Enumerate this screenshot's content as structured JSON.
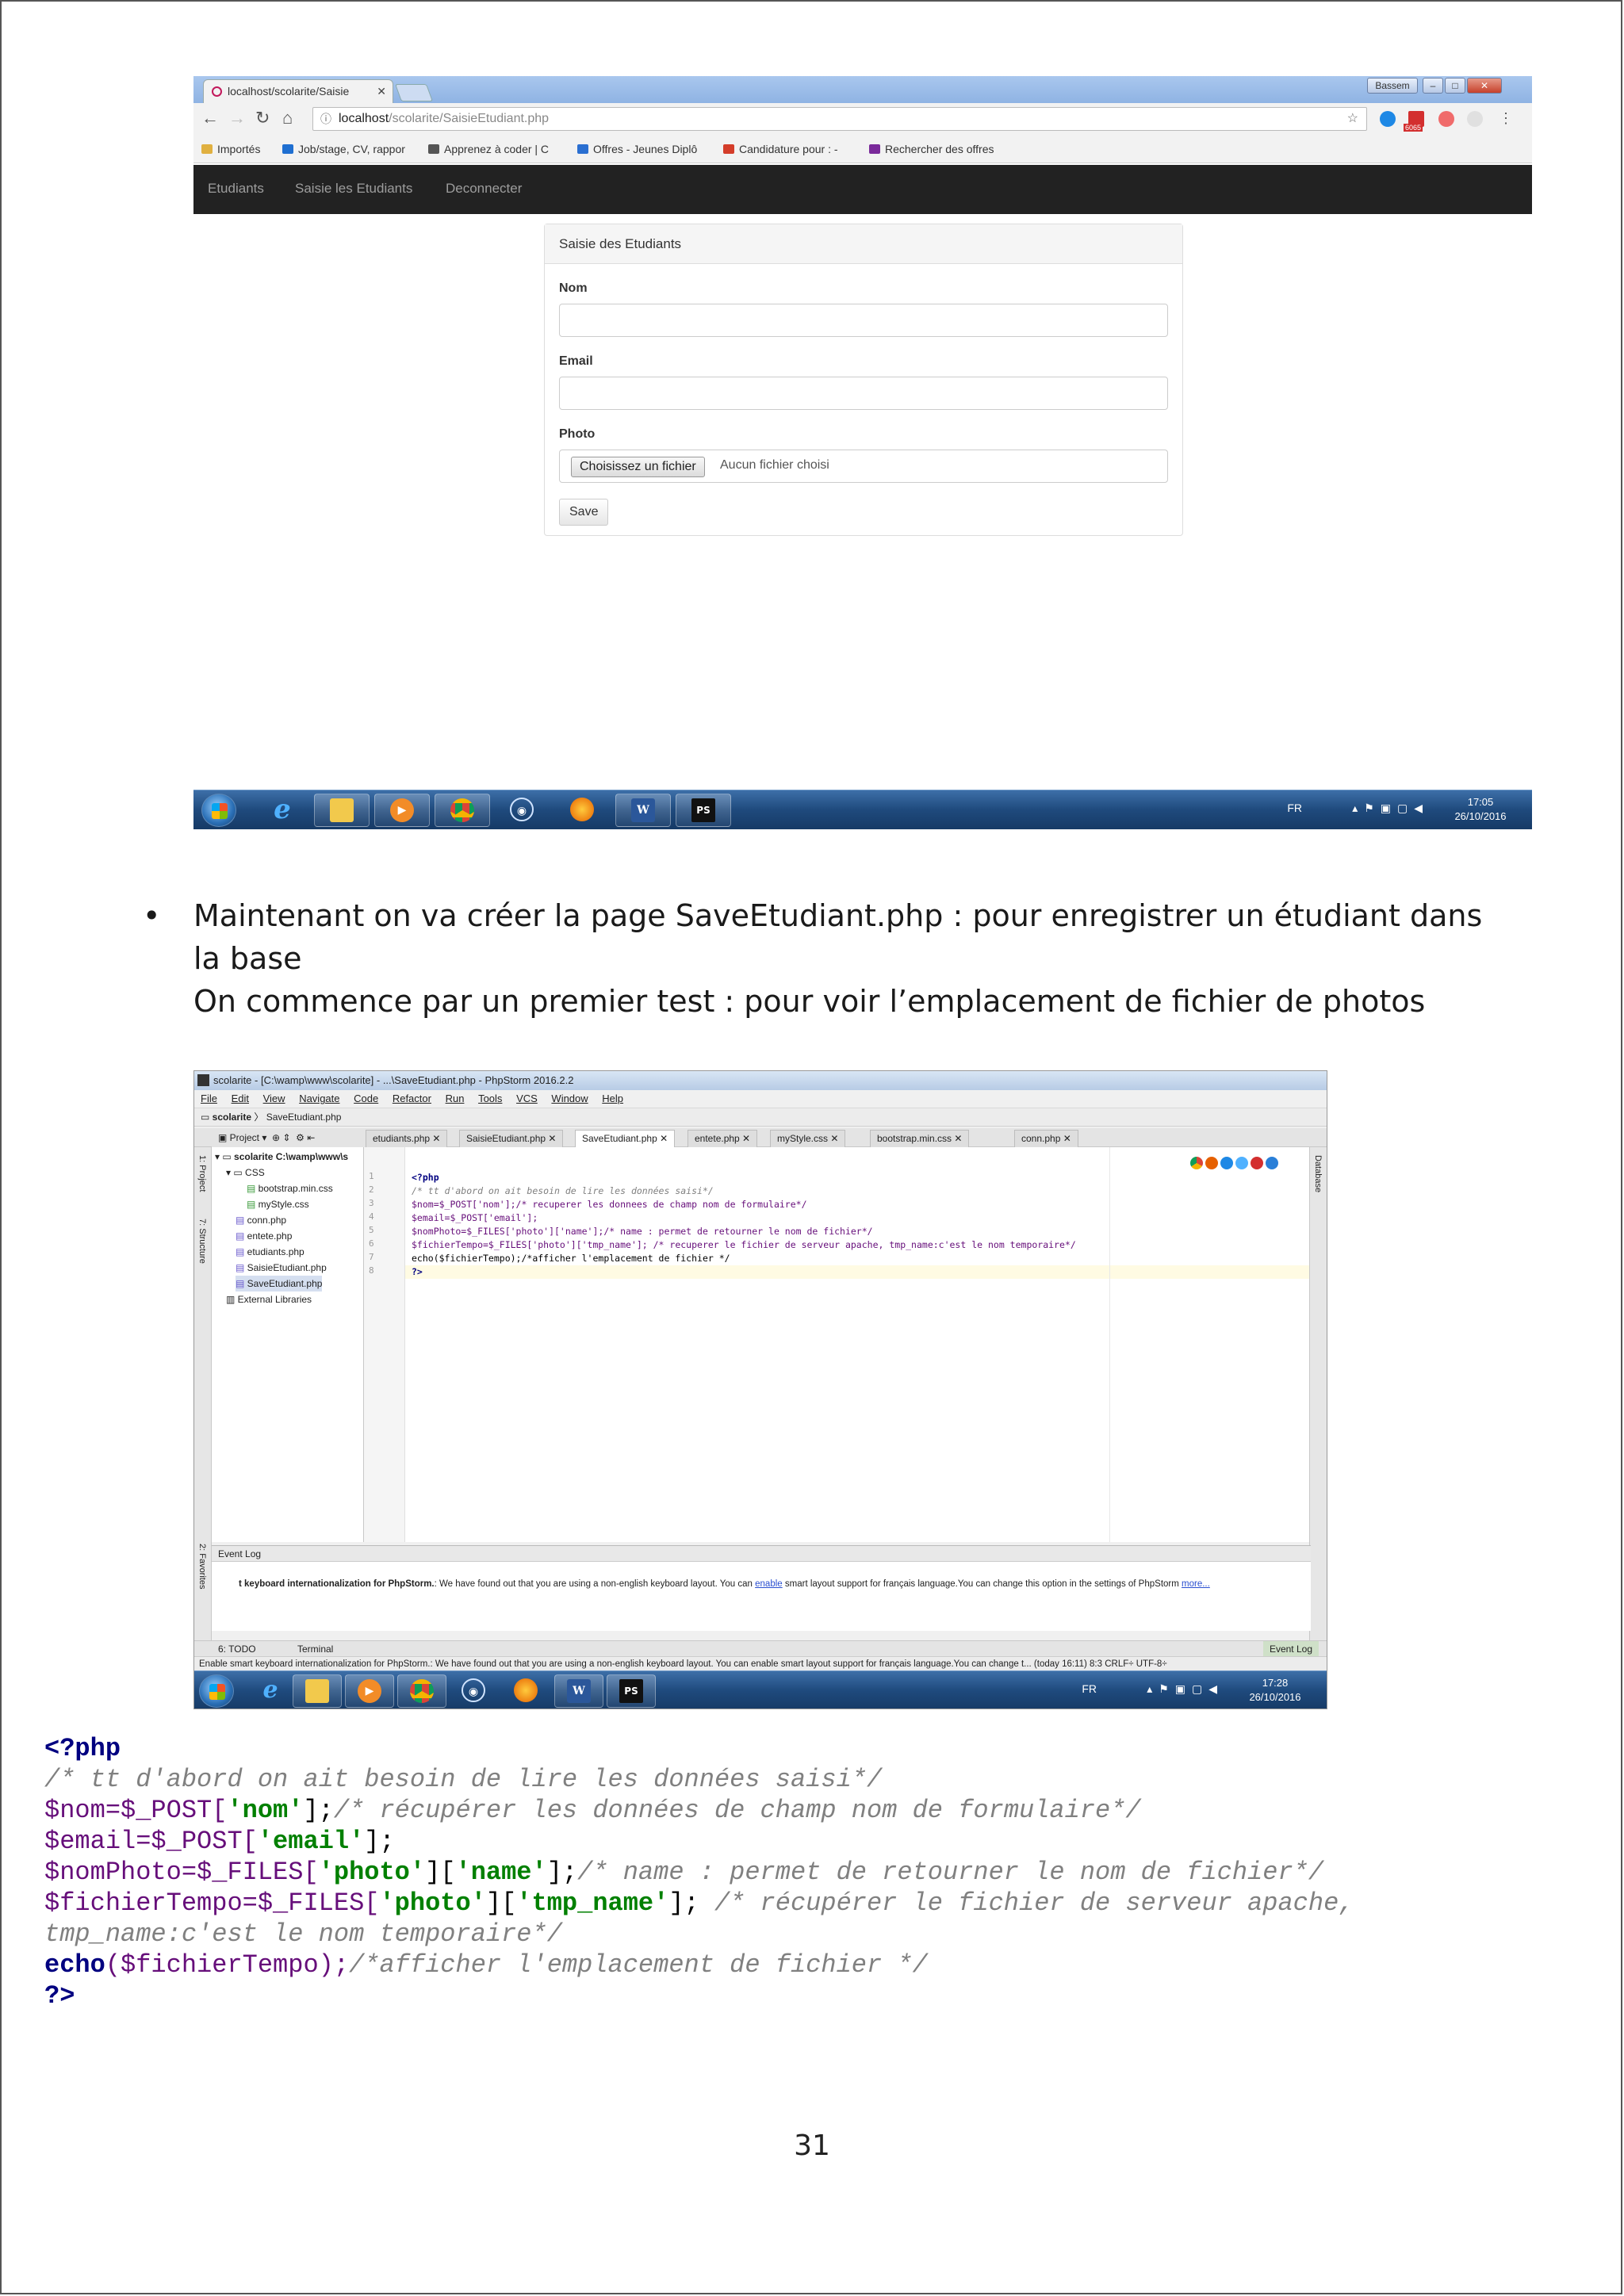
{
  "browser": {
    "tab_title": "localhost/scolarite/Saisie",
    "window_user": "Bassem",
    "url_host": "localhost",
    "url_path": "/scolarite/SaisieEtudiant.php",
    "extension_badge": "6065",
    "bookmarks": [
      {
        "label": "Importés",
        "color": "#e0b040"
      },
      {
        "label": "Job/stage, CV, rappor",
        "color": "#1f6fd1"
      },
      {
        "label": "Apprenez à coder | C",
        "color": "#555555"
      },
      {
        "label": "Offres - Jeunes Diplô",
        "color": "#2a6fd1"
      },
      {
        "label": "Candidature pour : -",
        "color": "#d43d2a"
      },
      {
        "label": "Rechercher des offres",
        "color": "#7a2a9a"
      }
    ]
  },
  "app": {
    "nav": [
      "Etudiants",
      "Saisie les Etudiants",
      "Deconnecter"
    ],
    "panel_title": "Saisie des Etudiants",
    "fields": {
      "nom": "Nom",
      "email": "Email",
      "photo": "Photo"
    },
    "file_button": "Choisissez un fichier",
    "file_status": "Aucun fichier choisi",
    "save_button": "Save"
  },
  "taskbar1": {
    "lang": "FR",
    "time": "17:05",
    "date": "26/10/2016"
  },
  "taskbar2": {
    "lang": "FR",
    "time": "17:28",
    "date": "26/10/2016"
  },
  "body": {
    "bullet_line1": "Maintenant on va créer la page SaveEtudiant.php : pour enregistrer un étudiant dans",
    "bullet_line2": "la base",
    "bullet_line3": "On commence par un premier test : pour voir l’emplacement de fichier de photos"
  },
  "ide": {
    "title": "scolarite - [C:\\wamp\\www\\scolarite] - ...\\SaveEtudiant.php - PhpStorm 2016.2.2",
    "menu": [
      "File",
      "Edit",
      "View",
      "Navigate",
      "Code",
      "Refactor",
      "Run",
      "Tools",
      "VCS",
      "Window",
      "Help"
    ],
    "breadcrumb": [
      "scolarite",
      "SaveEtudiant.php"
    ],
    "project_label": "Project",
    "tabs": [
      "etudiants.php",
      "SaisieEtudiant.php",
      "SaveEtudiant.php",
      "entete.php",
      "myStyle.css",
      "bootstrap.min.css",
      "conn.php"
    ],
    "active_tab": "SaveEtudiant.php",
    "tree": [
      {
        "label": "scolarite  C:\\wamp\\www\\s",
        "indent": 0,
        "icon": "folder-icon"
      },
      {
        "label": "CSS",
        "indent": 1,
        "icon": "folder-icon"
      },
      {
        "label": "bootstrap.min.css",
        "indent": 2,
        "icon": "css-file-icon"
      },
      {
        "label": "myStyle.css",
        "indent": 2,
        "icon": "css-file-icon"
      },
      {
        "label": "conn.php",
        "indent": 1,
        "icon": "php-file-icon"
      },
      {
        "label": "entete.php",
        "indent": 1,
        "icon": "php-file-icon"
      },
      {
        "label": "etudiants.php",
        "indent": 1,
        "icon": "php-file-icon"
      },
      {
        "label": "SaisieEtudiant.php",
        "indent": 1,
        "icon": "php-file-icon"
      },
      {
        "label": "SaveEtudiant.php",
        "indent": 1,
        "icon": "php-file-icon"
      },
      {
        "label": "External Libraries",
        "indent": 0,
        "icon": "library-icon"
      }
    ],
    "code": [
      "<?php",
      "/* tt d'abord on ait besoin de lire les données saisi*/",
      "$nom=$_POST['nom'];/* recuperer les donnees de champ nom de formulaire*/",
      "$email=$_POST['email'];",
      "$nomPhoto=$_FILES['photo']['name'];/* name : permet de retourner le nom de fichier*/",
      "$fichierTempo=$_FILES['photo']['tmp_name']; /* recuperer le fichier de serveur apache, tmp_name:c'est le nom temporaire*/",
      "echo($fichierTempo);/*afficher l'emplacement de fichier */",
      "?>"
    ],
    "side_left": [
      "1: Project",
      "7: Structure",
      "2: Favorites"
    ],
    "side_right": "Database",
    "event_log_title": "Event Log",
    "event_msg_bold": "t keyboard internationalization for PhpStorm.",
    "event_msg_text": ": We have found out that you are using a non-english keyboard layout. You can ",
    "event_msg_link": "enable",
    "event_msg_rest": " smart layout support for français language.You can change this option in the settings of PhpStorm ",
    "event_msg_more": "more...",
    "bottom_tabs": [
      "6: TODO",
      "Terminal"
    ],
    "event_log_tab": "Event Log",
    "status": "Enable smart keyboard internationalization for PhpStorm.: We have found out that you are using a non-english keyboard layout. You can enable smart layout support for français language.You can change t... (today 16:11)   8:3   CRLF÷   UTF-8÷"
  },
  "listing": {
    "l1": "<?php",
    "l2": "/* tt d'abord on ait besoin de lire les données saisi*/",
    "l3a": "$nom=$_POST[",
    "l3b": "'nom'",
    "l3c": "];",
    "l3d": "/* récupérer les données de champ nom de formulaire*/",
    "l4a": "$email=$_POST[",
    "l4b": "'email'",
    "l4c": "];",
    "l5a": "$nomPhoto=$_FILES[",
    "l5b": "'photo'",
    "l5c": "][",
    "l5d": "'name'",
    "l5e": "];",
    "l5f": "/* name : permet de retourner le nom de fichier*/",
    "l6a": "$fichierTempo=$_FILES[",
    "l6b": "'photo'",
    "l6c": "][",
    "l6d": "'tmp_name'",
    "l6e": "]; ",
    "l6f": "/* récupérer le fichier de serveur apache,",
    "l7": "tmp_name:c'est le nom temporaire*/",
    "l8a": "echo",
    "l8b": "($fichierTempo);",
    "l8c": "/*afficher l'emplacement de fichier */",
    "l9": "?>"
  },
  "page_number": "31"
}
